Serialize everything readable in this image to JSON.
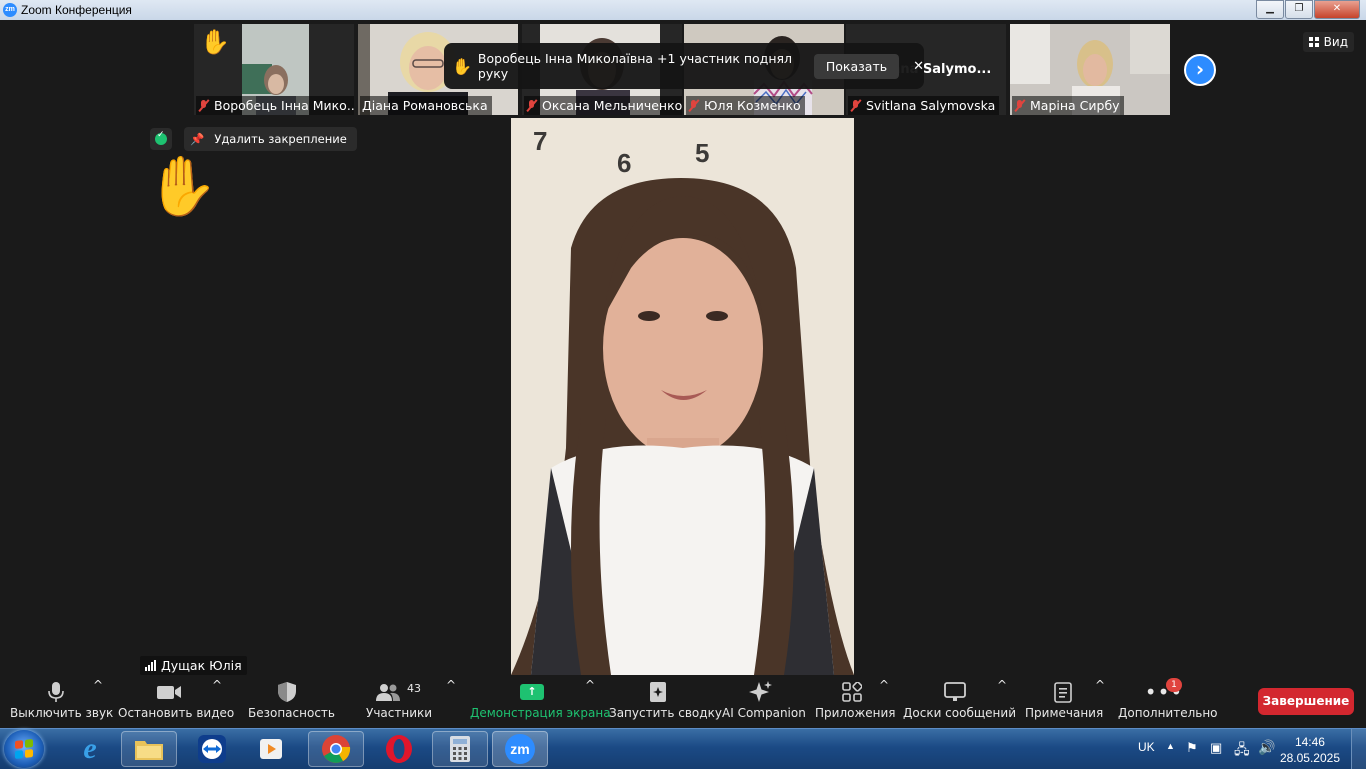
{
  "window": {
    "title": "Zoom Конференция",
    "logo": "zm"
  },
  "strip": {
    "participants": [
      {
        "name": "Воробець Інна Мико...",
        "raised_hand": true
      },
      {
        "name": "Діана Романовська"
      },
      {
        "name": "Оксана Мельниченко"
      },
      {
        "name": "Юля Козменко"
      },
      {
        "name": "Svitlana Salymovska"
      },
      {
        "name": "Маріна Сирбу"
      }
    ],
    "svitlana_overlay": "vitlana  Salymo..."
  },
  "view": {
    "label": "Вид"
  },
  "notification": {
    "text": "Воробець Інна Миколаївна +1 участник поднял руку",
    "show_label": "Показать",
    "close_glyph": "✕"
  },
  "pin": {
    "unpin_label": "Удалить закрепление"
  },
  "speaker": {
    "name": "Дущак Юлія",
    "wall_numbers": [
      "7",
      "6",
      "5"
    ]
  },
  "toolbar": {
    "mute_label": "Выключить звук",
    "video_label": "Остановить видео",
    "security_label": "Безопасность",
    "participants_label": "Участники",
    "participants_count": "43",
    "share_label": "Демонстрация экрана",
    "summary_label": "Запустить сводку",
    "ai_label": "AI Companion",
    "apps_label": "Приложения",
    "whiteboards_label": "Доски сообщений",
    "notes_label": "Примечания",
    "more_label": "Дополнительно",
    "more_badge": "1",
    "end_label": "Завершение"
  },
  "taskbar": {
    "lang": "UK",
    "time": "14:46",
    "date": "28.05.2025",
    "zoom_label": "zm"
  },
  "colors": {
    "accent": "#2d8cff",
    "end": "#d3272f",
    "share_green": "#1ec271",
    "mute_red": "#e0443e"
  }
}
